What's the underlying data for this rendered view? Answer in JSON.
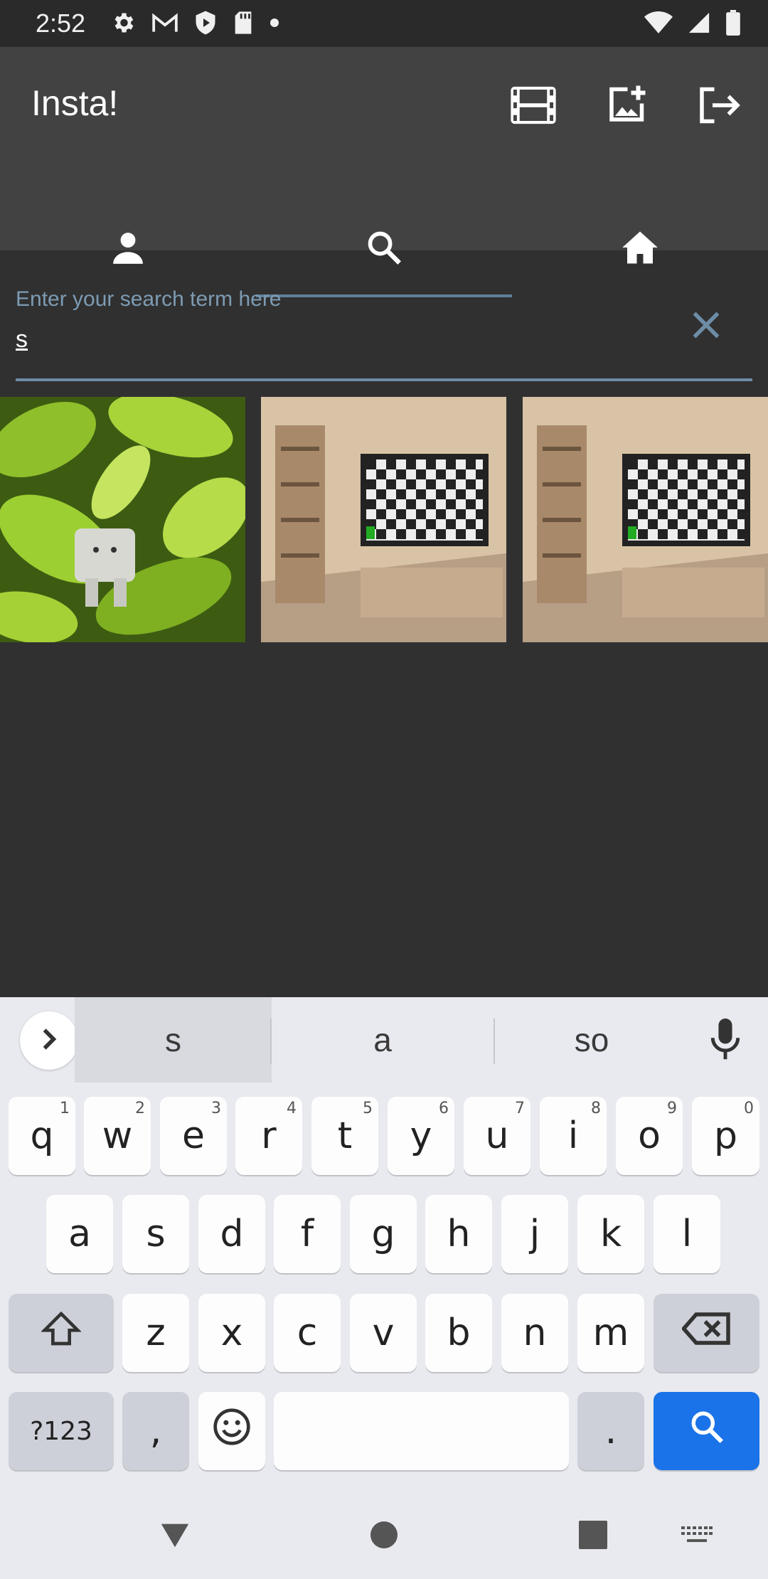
{
  "status_bar": {
    "time": "2:52",
    "left_icons": [
      "settings-icon",
      "gmail-icon",
      "shield-icon",
      "sd-card-icon",
      "dot-icon"
    ],
    "right_icons": [
      "wifi-icon",
      "signal-icon",
      "battery-icon"
    ]
  },
  "app_bar": {
    "title": "Insta!",
    "actions": [
      "reels-icon",
      "add-photo-icon",
      "logout-icon"
    ]
  },
  "tabs": [
    {
      "icon": "person-icon",
      "active": false
    },
    {
      "icon": "search-icon",
      "active": true
    },
    {
      "icon": "home-icon",
      "active": false
    }
  ],
  "search": {
    "placeholder": "Enter your search term here",
    "value": "s"
  },
  "results": [
    {
      "description": "leaves"
    },
    {
      "description": "room-tv"
    },
    {
      "description": "room-tv"
    }
  ],
  "keyboard": {
    "suggestions": [
      "s",
      "a",
      "so"
    ],
    "row1": [
      {
        "key": "q",
        "hint": "1"
      },
      {
        "key": "w",
        "hint": "2"
      },
      {
        "key": "e",
        "hint": "3"
      },
      {
        "key": "r",
        "hint": "4"
      },
      {
        "key": "t",
        "hint": "5"
      },
      {
        "key": "y",
        "hint": "6"
      },
      {
        "key": "u",
        "hint": "7"
      },
      {
        "key": "i",
        "hint": "8"
      },
      {
        "key": "o",
        "hint": "9"
      },
      {
        "key": "p",
        "hint": "0"
      }
    ],
    "row2": [
      "a",
      "s",
      "d",
      "f",
      "g",
      "h",
      "j",
      "k",
      "l"
    ],
    "row3": [
      "z",
      "x",
      "c",
      "v",
      "b",
      "n",
      "m"
    ],
    "symbols_label": "?123",
    "comma": ",",
    "period": ".",
    "accent_color": "#1a73e8"
  }
}
